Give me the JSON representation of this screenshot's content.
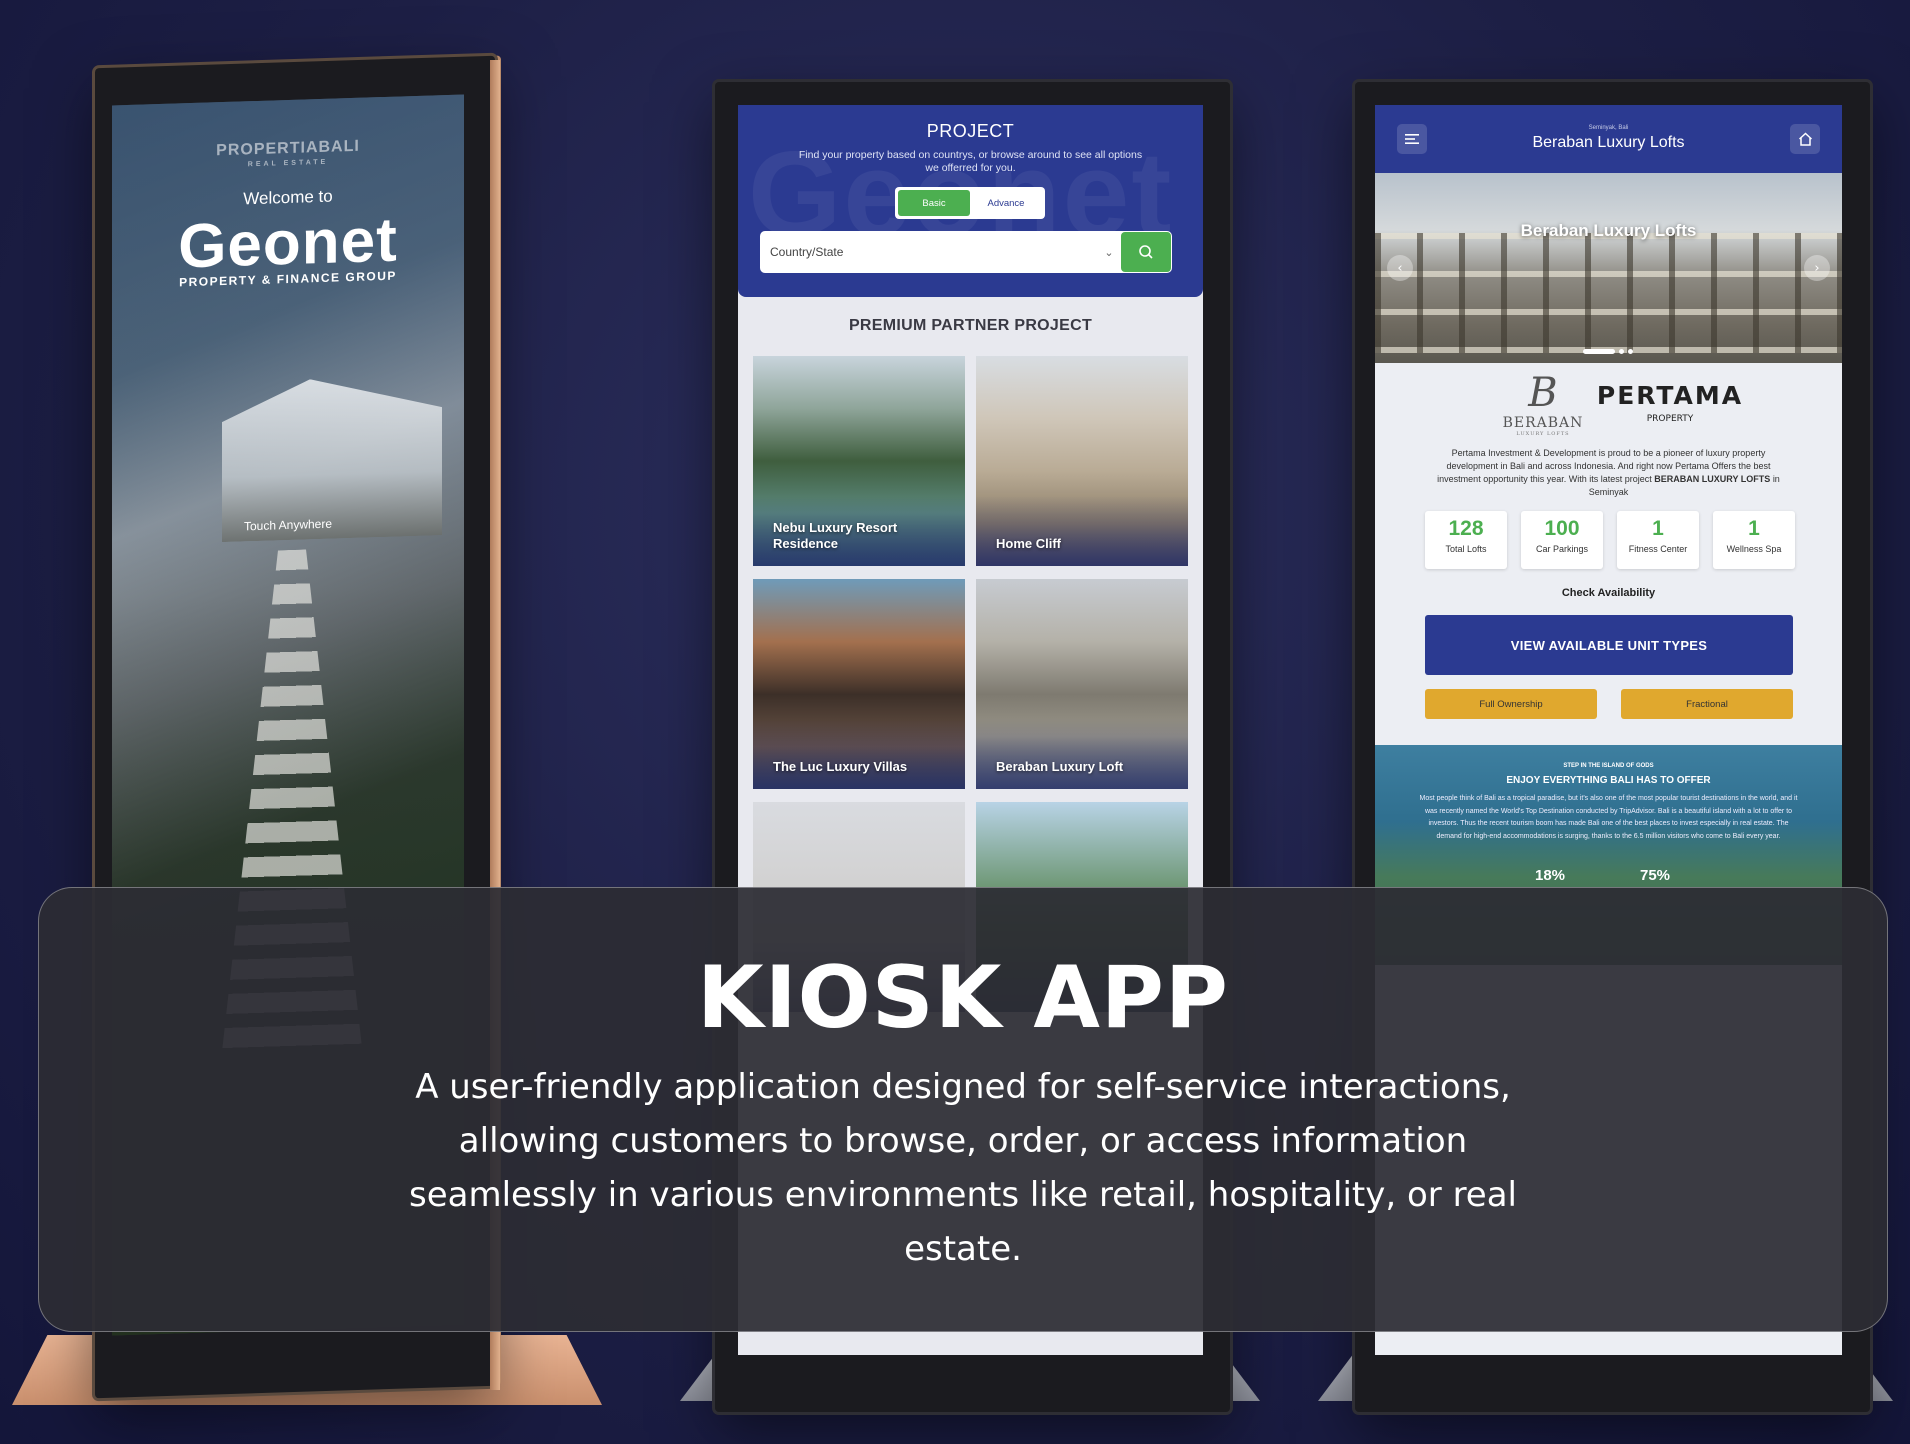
{
  "kiosk_welcome": {
    "brand": "PROPERTIABALI",
    "brand_sub": "REAL ESTATE",
    "welcome": "Welcome to",
    "logo": "Geonet",
    "logo_sub": "PROPERTY & FINANCE GROUP",
    "touch": "Touch Anywhere"
  },
  "kiosk_project": {
    "title": "PROJECT",
    "description": "Find your property based on countrys, or browse around to see all options we offerred for you.",
    "toggle": [
      "Basic",
      "Advance"
    ],
    "active_toggle": "Basic",
    "search_placeholder": "Country/State",
    "section_title": "PREMIUM PARTNER PROJECT",
    "cards": [
      {
        "label": "Nebu Luxury Resort Residence"
      },
      {
        "label": "Home Cliff"
      },
      {
        "label": "The Luc Luxury Villas"
      },
      {
        "label": "Beraban Luxury Loft"
      },
      {
        "label": ""
      },
      {
        "label": ""
      }
    ]
  },
  "kiosk_detail": {
    "location": "Seminyak, Bali",
    "title": "Beraban Luxury Lofts",
    "hero_title": "Beraban Luxury Lofts",
    "logo_left_mark": "B",
    "logo_left_name": "BERABAN",
    "logo_left_tag": "LUXURY LOFTS",
    "logo_right_name": "PERTAMA",
    "logo_right_sub": "PROPERTY",
    "intro": "Pertama Investment & Development is proud to be a pioneer of luxury property development in Bali and across Indonesia. And right now Pertama Offers the best investment opportunity this year. With its latest project",
    "intro_bold": "BERABAN LUXURY LOFTS",
    "intro_end": "in Seminyak",
    "stats": [
      {
        "value": "128",
        "label": "Total Lofts"
      },
      {
        "value": "100",
        "label": "Car Parkings"
      },
      {
        "value": "1",
        "label": "Fitness Center"
      },
      {
        "value": "1",
        "label": "Wellness Spa"
      }
    ],
    "check": "Check Availability",
    "view_button": "VIEW AVAILABLE UNIT TYPES",
    "ownership_buttons": [
      "Full Ownership",
      "Fractional"
    ],
    "bali_pre": "STEP IN THE ISLAND OF GODS",
    "bali_title": "ENJOY EVERYTHING BALI HAS TO OFFER",
    "bali_text": "Most people think of Bali as a tropical paradise, but it's also one of the most popular tourist destinations in the world, and it was recently named the World's Top Destination conducted by TripAdvisor. Bali is a beautiful island with a lot to offer to investors. Thus the recent tourism boom has made Bali one of the best places to invest especially in real estate. The demand for high-end accommodations is surging, thanks to the 6.5 million visitors who come to Bali every year.",
    "pct_left": "18%",
    "pct_right": "75%"
  },
  "overlay": {
    "headline": "KIOSK APP",
    "lead": "A user-friendly application designed for self-service interactions, allowing customers to browse, order, or access information seamlessly in various environments like retail, hospitality, or real estate."
  },
  "colors": {
    "brand_blue": "#2b3a91",
    "accent_green": "#4caf50",
    "accent_gold": "#e0a82e",
    "panel": "#2c2c34"
  }
}
